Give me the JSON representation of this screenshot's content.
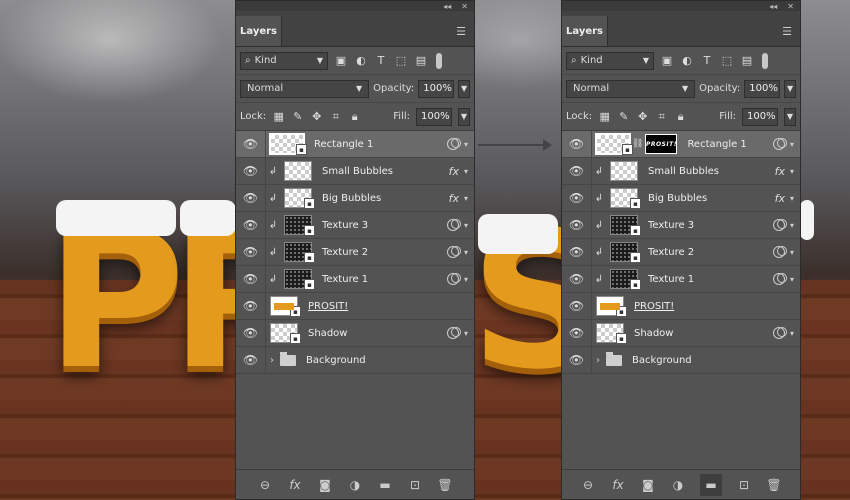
{
  "panels": [
    {
      "tab": "Layers",
      "kind_label": "Kind",
      "blend_mode": "Normal",
      "opacity_label": "Opacity:",
      "opacity_value": "100%",
      "lock_label": "Lock:",
      "fill_label": "Fill:",
      "fill_value": "100%",
      "layers": [
        {
          "name": "Rectangle 1"
        },
        {
          "name": "Small Bubbles"
        },
        {
          "name": "Big Bubbles"
        },
        {
          "name": "Texture 3"
        },
        {
          "name": "Texture 2"
        },
        {
          "name": "Texture 1"
        },
        {
          "name": "PROSIT!"
        },
        {
          "name": "Shadow"
        },
        {
          "name": "Background"
        }
      ]
    },
    {
      "tab": "Layers",
      "kind_label": "Kind",
      "blend_mode": "Normal",
      "opacity_label": "Opacity:",
      "opacity_value": "100%",
      "lock_label": "Lock:",
      "fill_label": "Fill:",
      "fill_value": "100%",
      "mask_text": "PROSIT!",
      "layers": [
        {
          "name": "Rectangle 1"
        },
        {
          "name": "Small Bubbles"
        },
        {
          "name": "Big Bubbles"
        },
        {
          "name": "Texture 3"
        },
        {
          "name": "Texture 2"
        },
        {
          "name": "Texture 1"
        },
        {
          "name": "PROSIT!"
        },
        {
          "name": "Shadow"
        },
        {
          "name": "Background"
        }
      ]
    }
  ],
  "background_letters": [
    "P",
    "R",
    "S"
  ],
  "colors": {
    "panel": "#535353",
    "selected": "#6a6a6a",
    "beer": "#e49a1c"
  }
}
